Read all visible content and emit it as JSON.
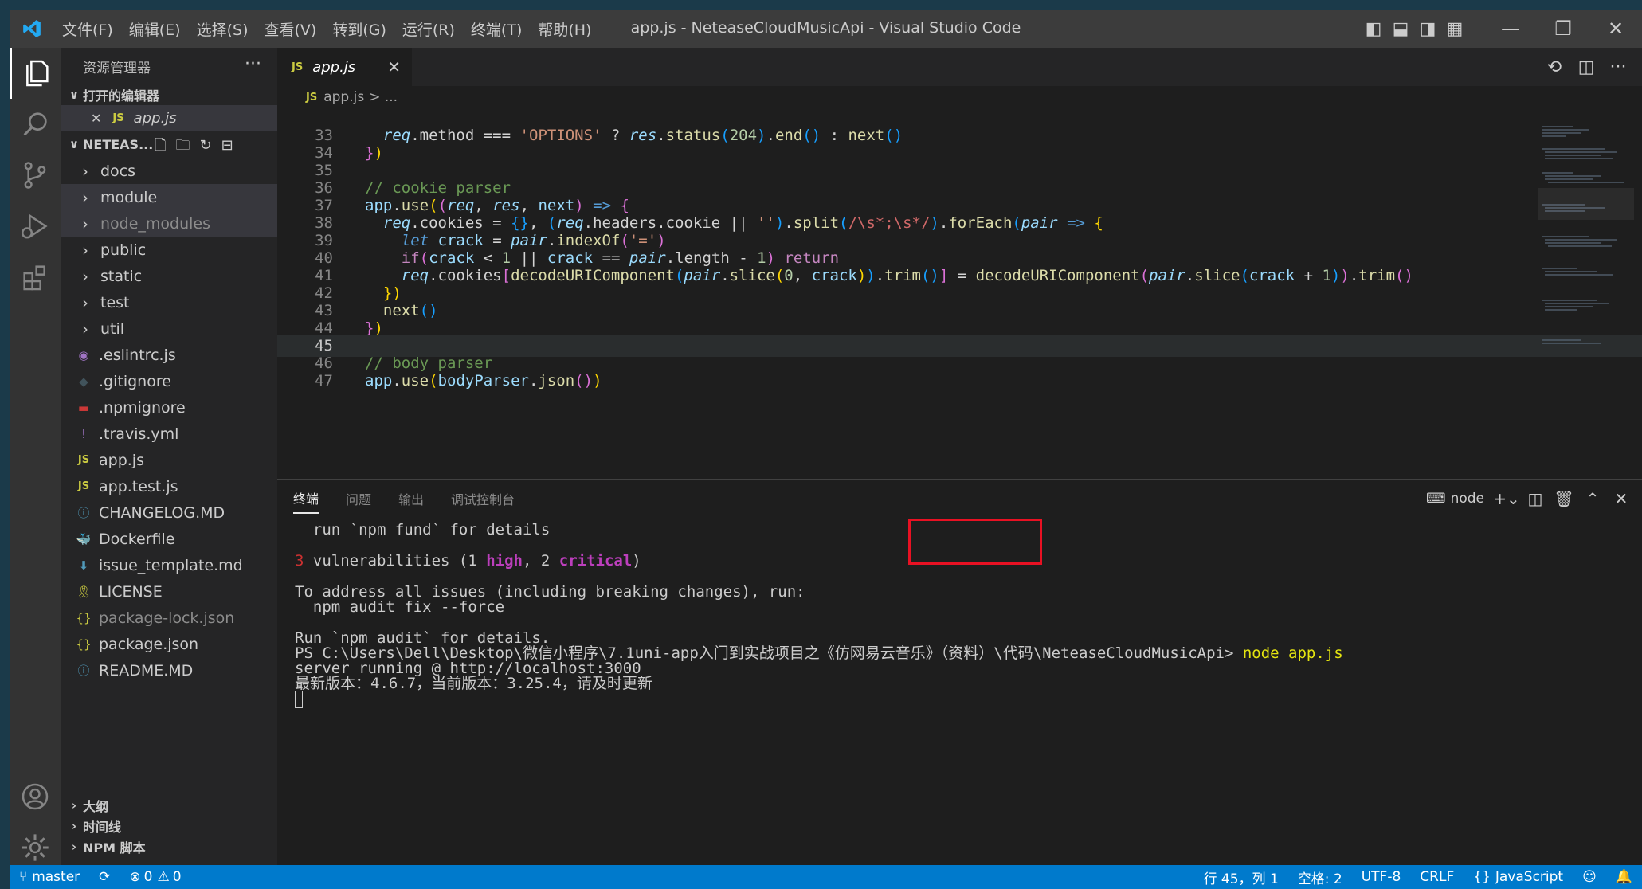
{
  "window": {
    "title": "app.js - NeteaseCloudMusicApi - Visual Studio Code",
    "menu": [
      "文件(F)",
      "编辑(E)",
      "选择(S)",
      "查看(V)",
      "转到(G)",
      "运行(R)",
      "终端(T)",
      "帮助(H)"
    ]
  },
  "sidebar": {
    "header": "资源管理器",
    "open_editors_label": "打开的编辑器",
    "open_editor_file": "app.js",
    "folder_label": "NETEAS...",
    "tree": [
      {
        "label": "docs",
        "kind": "folder"
      },
      {
        "label": "module",
        "kind": "folder"
      },
      {
        "label": "node_modules",
        "kind": "folder"
      },
      {
        "label": "public",
        "kind": "folder"
      },
      {
        "label": "static",
        "kind": "folder"
      },
      {
        "label": "test",
        "kind": "folder"
      },
      {
        "label": "util",
        "kind": "folder"
      },
      {
        "label": ".eslintrc.js",
        "kind": "eslint"
      },
      {
        "label": ".gitignore",
        "kind": "git"
      },
      {
        "label": ".npmignore",
        "kind": "npm"
      },
      {
        "label": ".travis.yml",
        "kind": "yml"
      },
      {
        "label": "app.js",
        "kind": "js"
      },
      {
        "label": "app.test.js",
        "kind": "js"
      },
      {
        "label": "CHANGELOG.MD",
        "kind": "md"
      },
      {
        "label": "Dockerfile",
        "kind": "docker"
      },
      {
        "label": "issue_template.md",
        "kind": "mdarrow"
      },
      {
        "label": "LICENSE",
        "kind": "license"
      },
      {
        "label": "package-lock.json",
        "kind": "json"
      },
      {
        "label": "package.json",
        "kind": "json"
      },
      {
        "label": "README.MD",
        "kind": "info"
      }
    ],
    "bottom_sections": [
      "大纲",
      "时间线",
      "NPM 脚本"
    ]
  },
  "editor": {
    "tab_label": "app.js",
    "tab_badge": "JS",
    "breadcrumb_file": "app.js",
    "breadcrumb_sep": "> ...",
    "line_numbers": [
      "33",
      "34",
      "35",
      "36",
      "37",
      "38",
      "39",
      "40",
      "41",
      "42",
      "43",
      "44",
      "45",
      "46",
      "47"
    ],
    "current_line": "45"
  },
  "panel": {
    "tabs": [
      "终端",
      "问题",
      "输出",
      "调试控制台"
    ],
    "shell": "node",
    "terminal": {
      "line1": "  run `npm fund` for details",
      "vuln_count": "3",
      "vuln_text_a": " vulnerabilities (1 ",
      "vuln_high": "high",
      "vuln_text_b": ", 2 ",
      "vuln_critical": "critical",
      "vuln_text_c": ")",
      "line3": "To address all issues (including breaking changes), run:",
      "line4": "  npm audit fix --force",
      "line5": "Run `npm audit` for details.",
      "prompt": "PS C:\\Users\\Dell\\Desktop\\微信小程序\\7.1uni-app入门到实战项目之《仿网易云音乐》（资料）\\代码\\NeteaseCloudMusicApi> ",
      "command": "node app.js",
      "line7": "server running @ http://localhost:3000",
      "line8": "最新版本：4.6.7，当前版本：3.25.4，请及时更新"
    }
  },
  "status": {
    "branch": "master",
    "errors": "0",
    "warnings": "0",
    "position": "行 45，列 1",
    "spaces": "空格: 2",
    "encoding": "UTF-8",
    "eol": "CRLF",
    "language": "JavaScript"
  },
  "colors": {
    "accent": "#007acc",
    "highlight_box": "#e81123"
  }
}
